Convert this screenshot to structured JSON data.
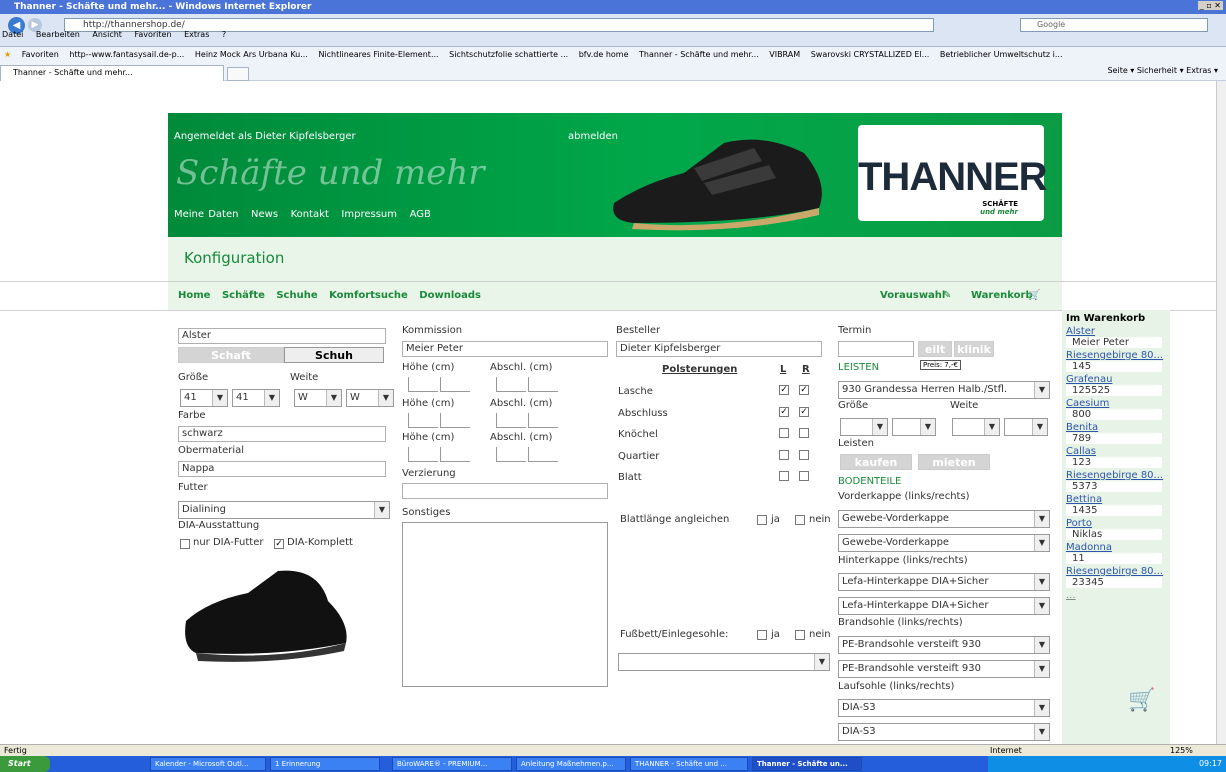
{
  "browser": {
    "title": "Thanner - Schäfte und mehr... - Windows Internet Explorer",
    "address": "http://thannershop.de/",
    "search_placeholder": "Google",
    "menu": [
      "Datei",
      "Bearbeiten",
      "Ansicht",
      "Favoriten",
      "Extras",
      "?"
    ],
    "favorites_label": "Favoriten",
    "favorites": [
      "http--www.fantasysail.de-p...",
      "Heinz Mock Ars Urbana Ku...",
      "Nichtlineares Finite-Element...",
      "Sichtschutzfolie schattierte ...",
      "bfv.de home",
      "Thanner - Schäfte und mehr...",
      "VIBRAM",
      "Swarovski CRYSTALLIZED El...",
      "Betrieblicher Umweltschutz i..."
    ],
    "tab_label": "Thanner - Schäfte und mehr...",
    "command_bar": "Seite ▾  Sicherheit ▾  Extras ▾",
    "status_left": "Fertig",
    "status_zone": "Internet",
    "zoom": "125%"
  },
  "header": {
    "logged_in": "Angemeldet als Dieter Kipfelsberger",
    "logout": "abmelden",
    "slogan": "Schäfte und mehr",
    "nav": [
      "Meine Daten",
      "News",
      "Kontakt",
      "Impressum",
      "AGB"
    ],
    "logo_brand": "THANNER",
    "logo_sub1": "SCHÄFTE",
    "logo_sub2": "und mehr",
    "section_title": "Konfiguration"
  },
  "subnav": {
    "items": [
      "Home",
      "Schäfte",
      "Schuhe",
      "Komfortsuche",
      "Downloads"
    ],
    "vorauswahl": "Vorauswahl",
    "warenkorb": "Warenkorb"
  },
  "form": {
    "model": "Alster",
    "tab_schaft": "Schaft",
    "tab_schuh": "Schuh",
    "groesse_label": "Größe",
    "weite_label": "Weite",
    "size_l": "41",
    "size_r": "41",
    "width_l": "W",
    "width_r": "W",
    "L": "L",
    "R": "R",
    "farbe_label": "Farbe",
    "farbe": "schwarz",
    "obermaterial_label": "Obermaterial",
    "obermaterial": "Nappa",
    "futter_label": "Futter",
    "futter": "Dialining",
    "dia_label": "DIA-Ausstattung",
    "dia_opt1": "nur DIA-Futter",
    "dia_opt2": "DIA-Komplett",
    "kommission_label": "Kommission",
    "kommission": "Meier Peter",
    "hoehe_label": "Höhe (cm)",
    "abschl_label": "Abschl. (cm)",
    "verzierung_label": "Verzierung",
    "sonstiges_label": "Sonstiges",
    "besteller_label": "Besteller",
    "besteller": "Dieter Kipfelsberger",
    "polster_label": "Polsterungen",
    "polster": [
      "Lasche",
      "Abschluss",
      "Knöchel",
      "Quartier",
      "Blatt"
    ],
    "blattlaenge_label": "Blattlänge angleichen",
    "ja": "ja",
    "nein": "nein",
    "fussbett_label": "Fußbett/Einlegesohle:",
    "termin_label": "Termin",
    "eilt": "eilt",
    "klinik": "klinik",
    "preis_tip": "Preis: 7,-€",
    "leisten_label": "LEISTEN",
    "leisten_select": "930 Grandessa Herren Halb./Stfl.",
    "leisten_text": "Leisten",
    "kaufen": "kaufen",
    "mieten": "mieten",
    "bodenteile_label": "BODENTEILE",
    "vorderkappe_label": "Vorderkappe (links/rechts)",
    "vorderkappe": "Gewebe-Vorderkappe",
    "hinterkappe_label": "Hinterkappe (links/rechts)",
    "hinterkappe": "Lefa-Hinterkappe DIA+Sicher",
    "brandsohle_label": "Brandsohle (links/rechts)",
    "brandsohle": "PE-Brandsohle versteift 930",
    "laufsohle_label": "Laufsohle (links/rechts)",
    "laufsohle": "DIA-S3"
  },
  "cart": {
    "title": "Im Warenkorb",
    "items": [
      {
        "name": "Alster",
        "val": "Meier Peter"
      },
      {
        "name": "Riesengebirge 80...",
        "val": "145"
      },
      {
        "name": "Grafenau",
        "val": "125525"
      },
      {
        "name": "Caesium",
        "val": "800"
      },
      {
        "name": "Benita",
        "val": "789"
      },
      {
        "name": "Callas",
        "val": "123"
      },
      {
        "name": "Riesengebirge 80...",
        "val": "5373"
      },
      {
        "name": "Bettina",
        "val": "1435"
      },
      {
        "name": "Porto",
        "val": "Niklas"
      },
      {
        "name": "Madonna",
        "val": "11"
      },
      {
        "name": "Riesengebirge 80...",
        "val": "23345"
      }
    ],
    "more": "..."
  },
  "taskbar": {
    "start": "Start",
    "items": [
      "Kalender - Microsoft Outl...",
      "1 Erinnerung",
      "BüroWARE® - PREMIUM...",
      "Anleitung Maßnehmen.p...",
      "THANNER - Schäfte und ...",
      "Thanner - Schäfte un..."
    ],
    "clock": "09:17"
  },
  "colors": {
    "brand_green": "#00a84a",
    "link_green": "#1a8a3a",
    "light_green": "#e9f5e8"
  }
}
